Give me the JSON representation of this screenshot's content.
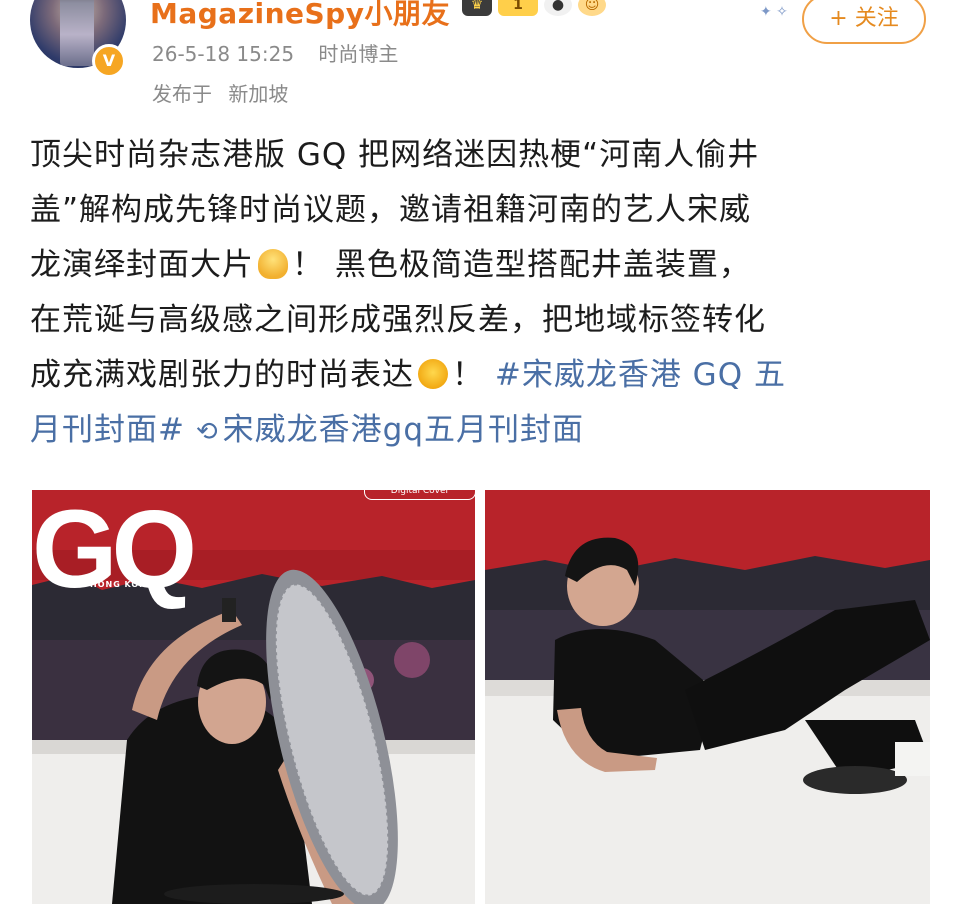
{
  "header": {
    "username": "MagazineSpy小朋友",
    "verified_mark": "V",
    "badge_level": "1",
    "badges": [
      "crown-badge-icon",
      "level-badge-icon",
      "panda-badge-icon",
      "cat-badge-icon"
    ],
    "timestamp": "26-5-18 15:25",
    "user_type": "时尚博主",
    "location_prefix": "发布于",
    "location": "新加坡",
    "follow_label": "+ 关注"
  },
  "post": {
    "line1": "顶尖时尚杂志港版 GQ 把网络迷因热梗“河南人偷井",
    "line2": "盖”解构成先锋时尚议题，邀请祖籍河南的艺人宋威",
    "line3a": "龙演绎封面大片",
    "line3b": "！ 黑色极简造型搭配井盖装置，",
    "line4": "在荒诞与高级感之间形成强烈反差，把地域标签转化",
    "line5a": "成充满戏剧张力的时尚表达",
    "line5b": "！",
    "hashtag_line5": "#宋威龙香港 GQ 五",
    "hashtag_line6": "月刊封面#",
    "search_link": "宋威龙香港gq五月刊封面"
  },
  "images": {
    "left": {
      "logo": "GQ",
      "sublogo": "HONG KONG",
      "tag": "Digital Cover"
    }
  },
  "colors": {
    "accent_orange": "#e8701a",
    "link_blue": "#4a6fa5",
    "meta_gray": "#8a8a8a",
    "backdrop_red": "#b8232a"
  }
}
